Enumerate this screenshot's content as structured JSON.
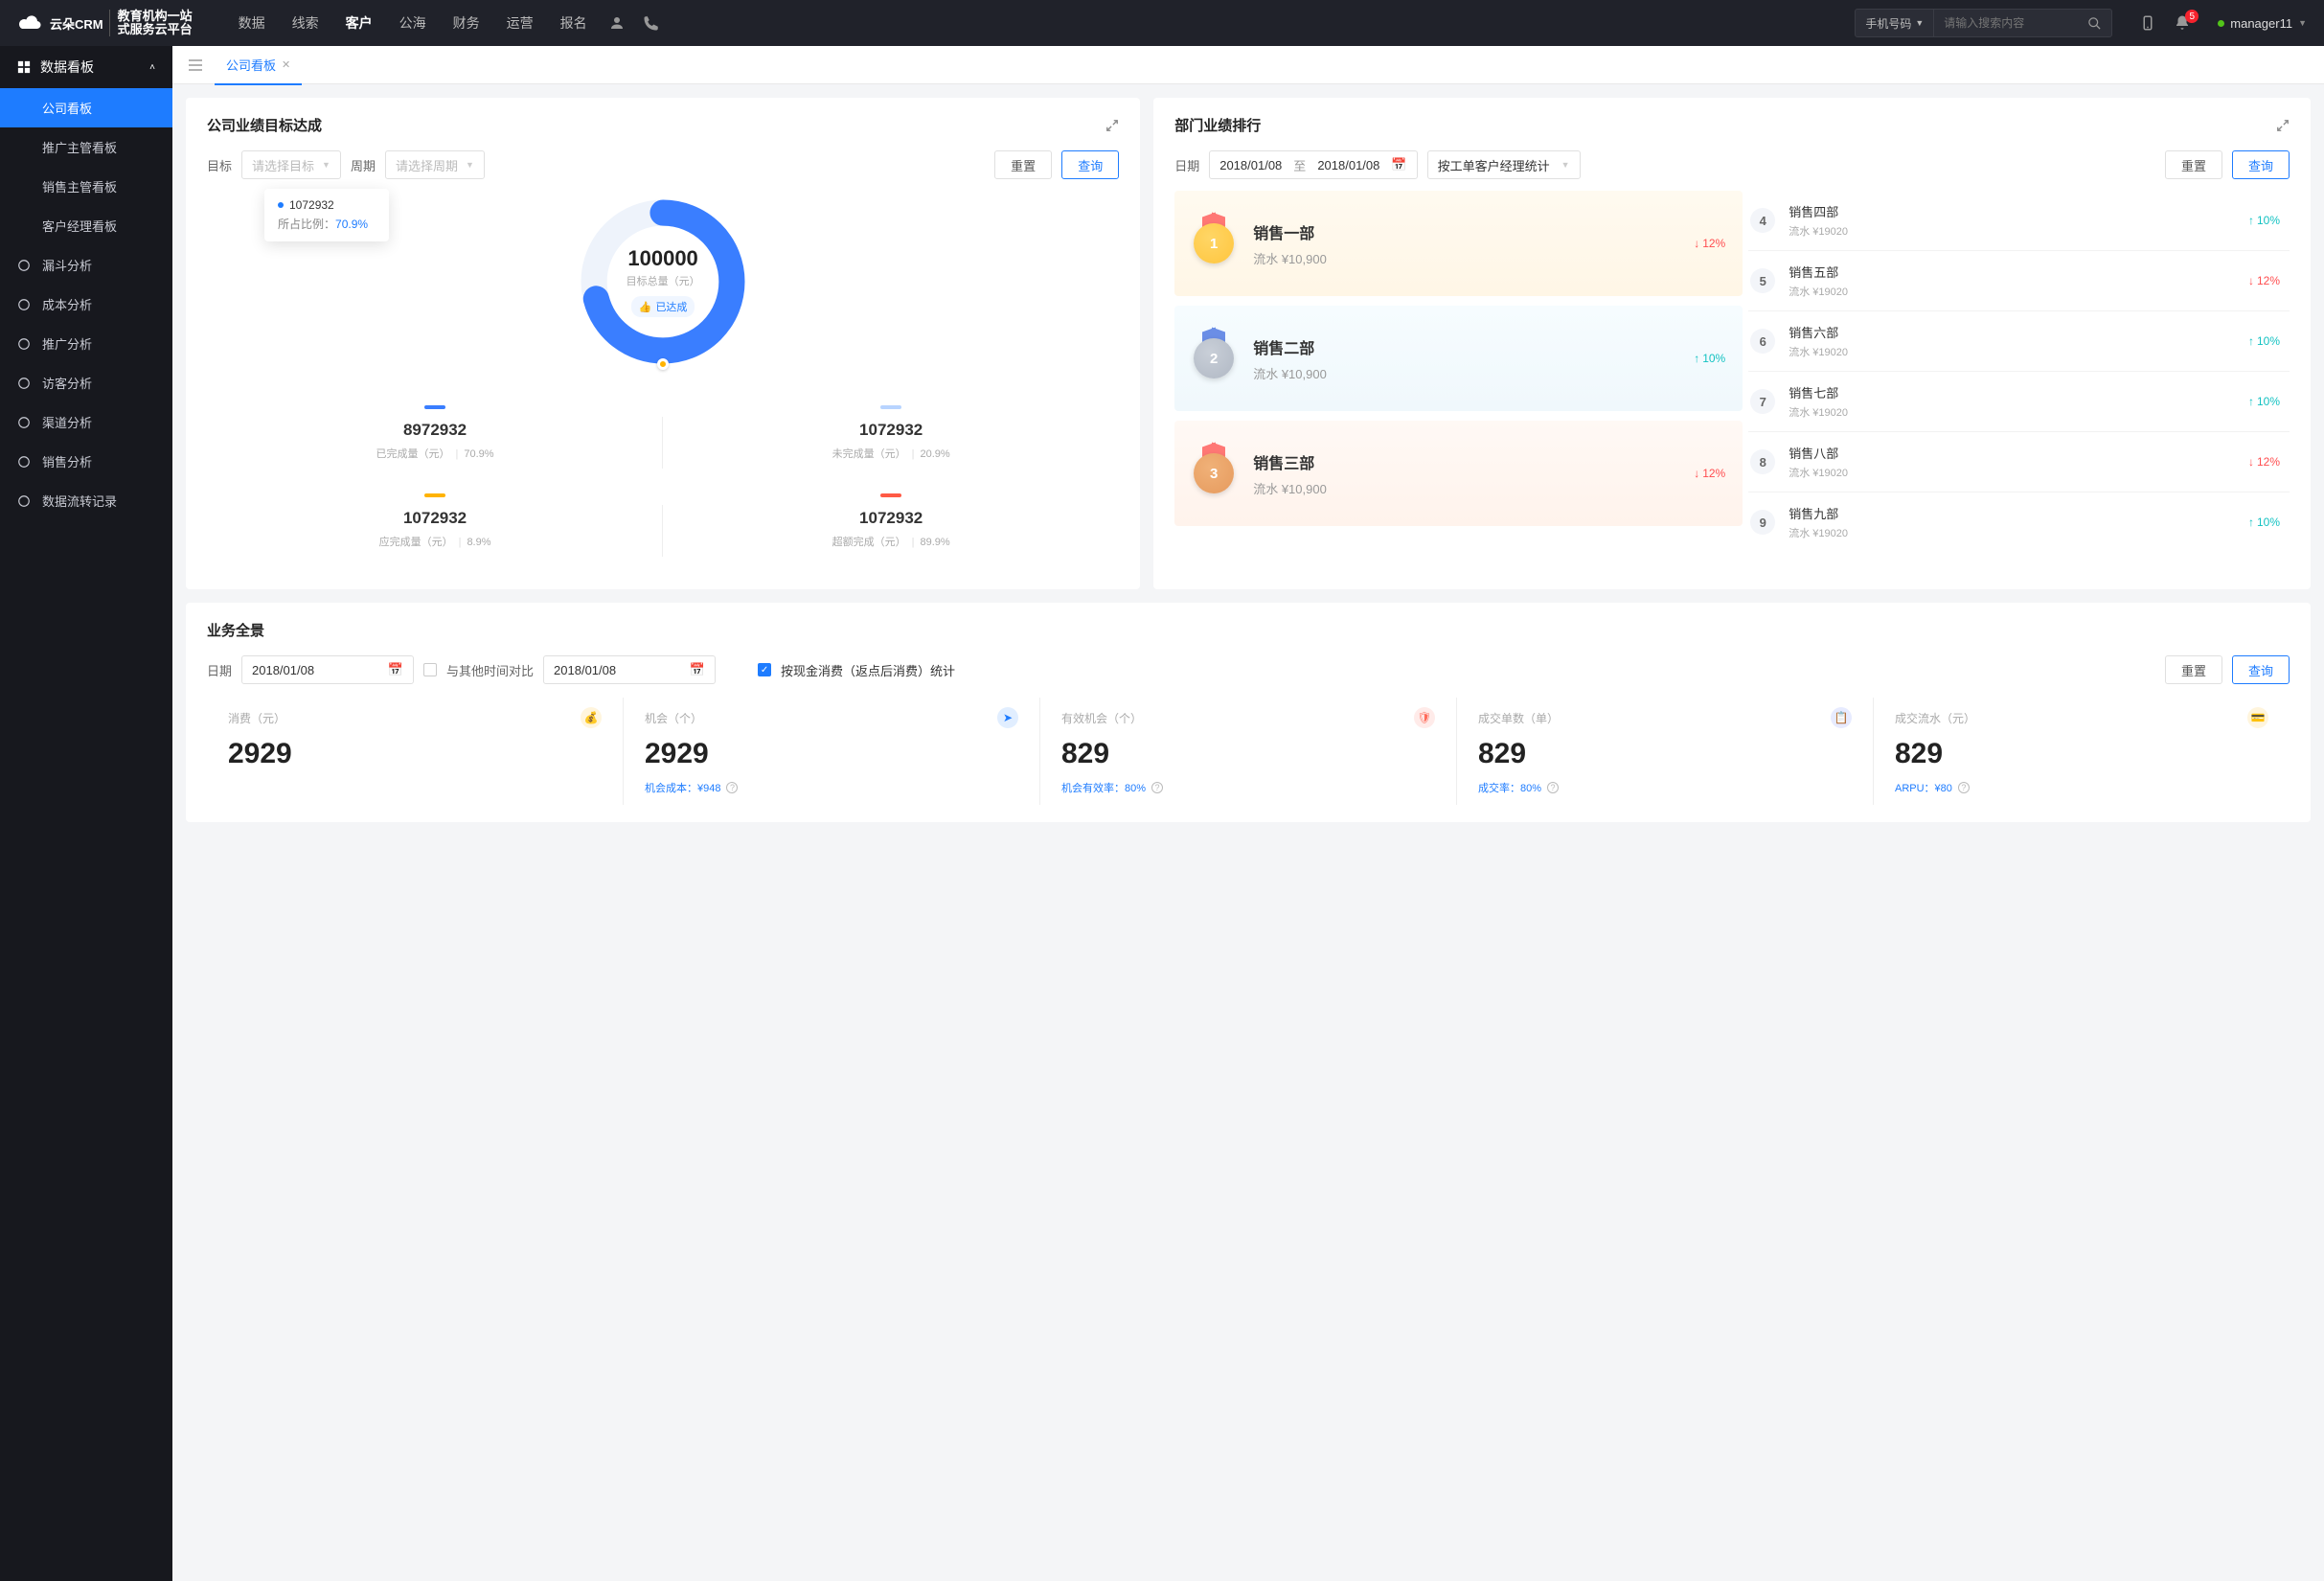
{
  "topnav": {
    "logo_main": "云朵CRM",
    "logo_sub1": "教育机构一站",
    "logo_sub2": "式服务云平台",
    "items": [
      "数据",
      "线索",
      "客户",
      "公海",
      "财务",
      "运营",
      "报名"
    ],
    "active_index": 2,
    "search_type": "手机号码",
    "search_placeholder": "请输入搜索内容",
    "notif_count": "5",
    "user": "manager11"
  },
  "sidebar": {
    "group_title": "数据看板",
    "sub_items": [
      "公司看板",
      "推广主管看板",
      "销售主管看板",
      "客户经理看板"
    ],
    "sub_active": 0,
    "fn_items": [
      "漏斗分析",
      "成本分析",
      "推广分析",
      "访客分析",
      "渠道分析",
      "销售分析",
      "数据流转记录"
    ]
  },
  "tabs": {
    "tab1": "公司看板"
  },
  "panel_goal": {
    "title": "公司业绩目标达成",
    "label_target": "目标",
    "target_placeholder": "请选择目标",
    "label_period": "周期",
    "period_placeholder": "请选择周期",
    "reset": "重置",
    "query": "查询",
    "tooltip_value": "1072932",
    "tooltip_label": "所占比例：",
    "tooltip_pct": "70.9%",
    "center_value": "100000",
    "center_label": "目标总量（元）",
    "tag": "已达成",
    "stats": [
      {
        "color": "#3a7eff",
        "value": "8972932",
        "label": "已完成量（元）",
        "pct": "70.9%"
      },
      {
        "color": "#b8d4ff",
        "value": "1072932",
        "label": "未完成量（元）",
        "pct": "20.9%"
      },
      {
        "color": "#ffb300",
        "value": "1072932",
        "label": "应完成量（元）",
        "pct": "8.9%"
      },
      {
        "color": "#ff5a45",
        "value": "1072932",
        "label": "超额完成（元）",
        "pct": "89.9%"
      }
    ]
  },
  "panel_rank": {
    "title": "部门业绩排行",
    "label_date": "日期",
    "date_from": "2018/01/08",
    "date_to_label": "至",
    "date_to": "2018/01/08",
    "method_label": "按工单客户经理统计",
    "reset": "重置",
    "query": "查询",
    "flow_prefix": "流水",
    "top3": [
      {
        "rank": "1",
        "name": "销售一部",
        "flow": "¥10,900",
        "delta": "12%",
        "dir": "down",
        "disc": "#ffc53d",
        "outer": "#ffd666",
        "ribbon": "#ff7875"
      },
      {
        "rank": "2",
        "name": "销售二部",
        "flow": "¥10,900",
        "delta": "10%",
        "dir": "up",
        "disc": "#b0b8c4",
        "outer": "#c9cfd8",
        "ribbon": "#6b8ee6"
      },
      {
        "rank": "3",
        "name": "销售三部",
        "flow": "¥10,900",
        "delta": "12%",
        "dir": "down",
        "disc": "#e69a5d",
        "outer": "#f0b178",
        "ribbon": "#ff7875"
      }
    ],
    "rest": [
      {
        "rank": "4",
        "name": "销售四部",
        "flow": "¥19020",
        "delta": "10%",
        "dir": "up"
      },
      {
        "rank": "5",
        "name": "销售五部",
        "flow": "¥19020",
        "delta": "12%",
        "dir": "down"
      },
      {
        "rank": "6",
        "name": "销售六部",
        "flow": "¥19020",
        "delta": "10%",
        "dir": "up"
      },
      {
        "rank": "7",
        "name": "销售七部",
        "flow": "¥19020",
        "delta": "10%",
        "dir": "up"
      },
      {
        "rank": "8",
        "name": "销售八部",
        "flow": "¥19020",
        "delta": "12%",
        "dir": "down"
      },
      {
        "rank": "9",
        "name": "销售九部",
        "flow": "¥19020",
        "delta": "10%",
        "dir": "up"
      }
    ]
  },
  "panel_biz": {
    "title": "业务全景",
    "label_date": "日期",
    "date1": "2018/01/08",
    "compare_label": "与其他时间对比",
    "date2": "2018/01/08",
    "check_label": "按现金消费（返点后消费）统计",
    "reset": "重置",
    "query": "查询",
    "cards": [
      {
        "label": "消费（元）",
        "value": "2929",
        "foot": "",
        "ico": "#ffb300"
      },
      {
        "label": "机会（个）",
        "value": "2929",
        "foot": "机会成本：¥948",
        "ico": "#1e7cff"
      },
      {
        "label": "有效机会（个）",
        "value": "829",
        "foot": "机会有效率：80%",
        "ico": "#ff6b5a"
      },
      {
        "label": "成交单数（单）",
        "value": "829",
        "foot": "成交率：80%",
        "ico": "#4a6bff"
      },
      {
        "label": "成交流水（元）",
        "value": "829",
        "foot": "ARPU：¥80",
        "ico": "#ffb300"
      }
    ]
  },
  "chart_data": {
    "type": "pie",
    "title": "公司业绩目标达成",
    "total_label": "目标总量（元）",
    "total": 100000,
    "series": [
      {
        "name": "已完成量（元）",
        "value": 8972932,
        "pct": 70.9,
        "color": "#3a7eff"
      },
      {
        "name": "未完成量（元）",
        "value": 1072932,
        "pct": 20.9,
        "color": "#b8d4ff"
      },
      {
        "name": "应完成量（元）",
        "value": 1072932,
        "pct": 8.9,
        "color": "#ffb300"
      },
      {
        "name": "超额完成（元）",
        "value": 1072932,
        "pct": 89.9,
        "color": "#ff5a45"
      }
    ],
    "tooltip": {
      "value": 1072932,
      "pct": 70.9
    }
  }
}
